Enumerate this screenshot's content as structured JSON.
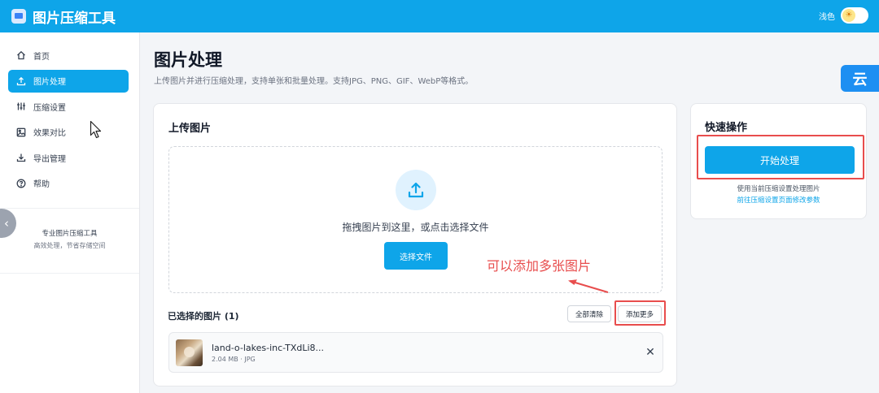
{
  "app": {
    "title": "图片压缩工具",
    "theme_label": "浅色",
    "theme_icon": "sun-icon"
  },
  "sidebar": {
    "items": [
      {
        "label": "首页",
        "icon": "home-icon",
        "active": false
      },
      {
        "label": "图片处理",
        "icon": "upload-icon",
        "active": true
      },
      {
        "label": "压缩设置",
        "icon": "sliders-icon",
        "active": false
      },
      {
        "label": "效果对比",
        "icon": "image-icon",
        "active": false
      },
      {
        "label": "导出管理",
        "icon": "download-icon",
        "active": false
      },
      {
        "label": "帮助",
        "icon": "help-icon",
        "active": false
      }
    ],
    "footer_title": "专业图片压缩工具",
    "footer_sub": "高效处理，节省存储空间"
  },
  "page": {
    "title": "图片处理",
    "subtitle": "上传图片并进行压缩处理，支持单张和批量处理。支持JPG、PNG、GIF、WebP等格式。"
  },
  "upload": {
    "title": "上传图片",
    "drop_text": "拖拽图片到这里，或点击选择文件",
    "choose_button": "选择文件",
    "selected_title": "已选择的图片 (1)",
    "clear_all": "全部清除",
    "add_more": "添加更多",
    "files": [
      {
        "name": "land-o-lakes-inc-TXdLi8...",
        "meta": "2.04 MB · JPG"
      }
    ]
  },
  "quick": {
    "title": "快速操作",
    "start_button": "开始处理",
    "hint": "使用当前压缩设置处理图片",
    "link": "前往压缩设置页面修改参数"
  },
  "annotation": {
    "text": "可以添加多张图片"
  },
  "float_badge": "云",
  "colors": {
    "primary": "#0ea5e9",
    "annotation_red": "#e84d4d"
  }
}
